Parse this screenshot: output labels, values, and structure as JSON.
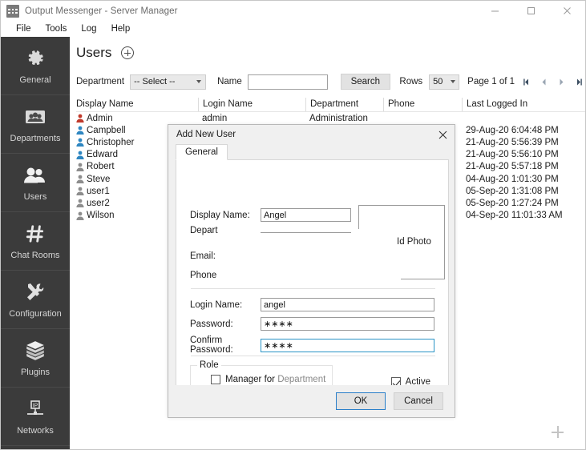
{
  "window": {
    "title": "Output Messenger - Server Manager",
    "icon": "app-icon",
    "controls": {
      "minimize": "─",
      "maximize": "□",
      "close": "✕"
    }
  },
  "menu": {
    "items": [
      "File",
      "Tools",
      "Log",
      "Help"
    ]
  },
  "sidebar": {
    "items": [
      {
        "label": "General",
        "icon": "gear-icon"
      },
      {
        "label": "Departments",
        "icon": "departments-icon"
      },
      {
        "label": "Users",
        "icon": "users-icon"
      },
      {
        "label": "Chat Rooms",
        "icon": "hash-icon"
      },
      {
        "label": "Configuration",
        "icon": "tools-icon"
      },
      {
        "label": "Plugins",
        "icon": "box-icon"
      },
      {
        "label": "Networks",
        "icon": "network-ip-icon"
      }
    ]
  },
  "page": {
    "title": "Users",
    "add_button": "add-user-plus"
  },
  "filter": {
    "department_label": "Department",
    "department_value": "-- Select --",
    "name_label": "Name",
    "name_value": "",
    "search_button": "Search",
    "rows_label": "Rows",
    "rows_value": "50",
    "page_text": "Page 1 of 1"
  },
  "table": {
    "columns": [
      "Display Name",
      "Login Name",
      "Department",
      "Phone",
      "Last Logged In"
    ],
    "rows": [
      {
        "display": "Admin",
        "status": "#c0392b",
        "login": "admin",
        "dept": "Administration",
        "phone": "",
        "last": ""
      },
      {
        "display": "Campbell",
        "status": "#2e86c1",
        "login": "",
        "dept": "",
        "phone": "",
        "last": "29-Aug-20 6:04:48 PM"
      },
      {
        "display": "Christopher",
        "status": "#2e86c1",
        "login": "",
        "dept": "",
        "phone": "",
        "last": "21-Aug-20 5:56:39 PM"
      },
      {
        "display": "Edward",
        "status": "#2e86c1",
        "login": "",
        "dept": "",
        "phone": "",
        "last": "21-Aug-20 5:56:10 PM"
      },
      {
        "display": "Robert",
        "status": "#8d8d8d",
        "login": "",
        "dept": "",
        "phone": "",
        "last": "21-Aug-20 5:57:18 PM"
      },
      {
        "display": "Steve",
        "status": "#8d8d8d",
        "login": "",
        "dept": "",
        "phone": "",
        "last": "04-Aug-20 1:01:30 PM"
      },
      {
        "display": "user1",
        "status": "#8d8d8d",
        "login": "",
        "dept": "",
        "phone": "",
        "last": "05-Sep-20 1:31:08 PM"
      },
      {
        "display": "user2",
        "status": "#8d8d8d",
        "login": "",
        "dept": "",
        "phone": "",
        "last": "05-Sep-20 1:27:24 PM"
      },
      {
        "display": "Wilson",
        "status": "#8d8d8d",
        "login": "",
        "dept": "",
        "phone": "",
        "last": "04-Sep-20 11:01:33 AM"
      }
    ]
  },
  "dialog": {
    "title": "Add New User",
    "close_icon": "✕",
    "tab": "General",
    "fields": {
      "display_name_label": "Display Name:",
      "display_name_value": "Angel",
      "department_label": "Depart",
      "email_label": "Email:",
      "phone_label": "Phone",
      "photo_label": "Id Photo",
      "login_name_label": "Login Name:",
      "login_name_value": "angel",
      "password_label": "Password:",
      "password_value": "∗∗∗∗",
      "confirm_password_label": "Confirm Password:",
      "confirm_password_value": "∗∗∗∗"
    },
    "role": {
      "legend": "Role",
      "manager_checkbox_label_1": "Manager for ",
      "manager_checkbox_label_2": "Department",
      "manager_checked": false,
      "active_label": "Active",
      "active_checked": true
    },
    "buttons": {
      "ok": "OK",
      "cancel": "Cancel"
    }
  },
  "misc": {
    "corner_plus": "floating-plus"
  }
}
